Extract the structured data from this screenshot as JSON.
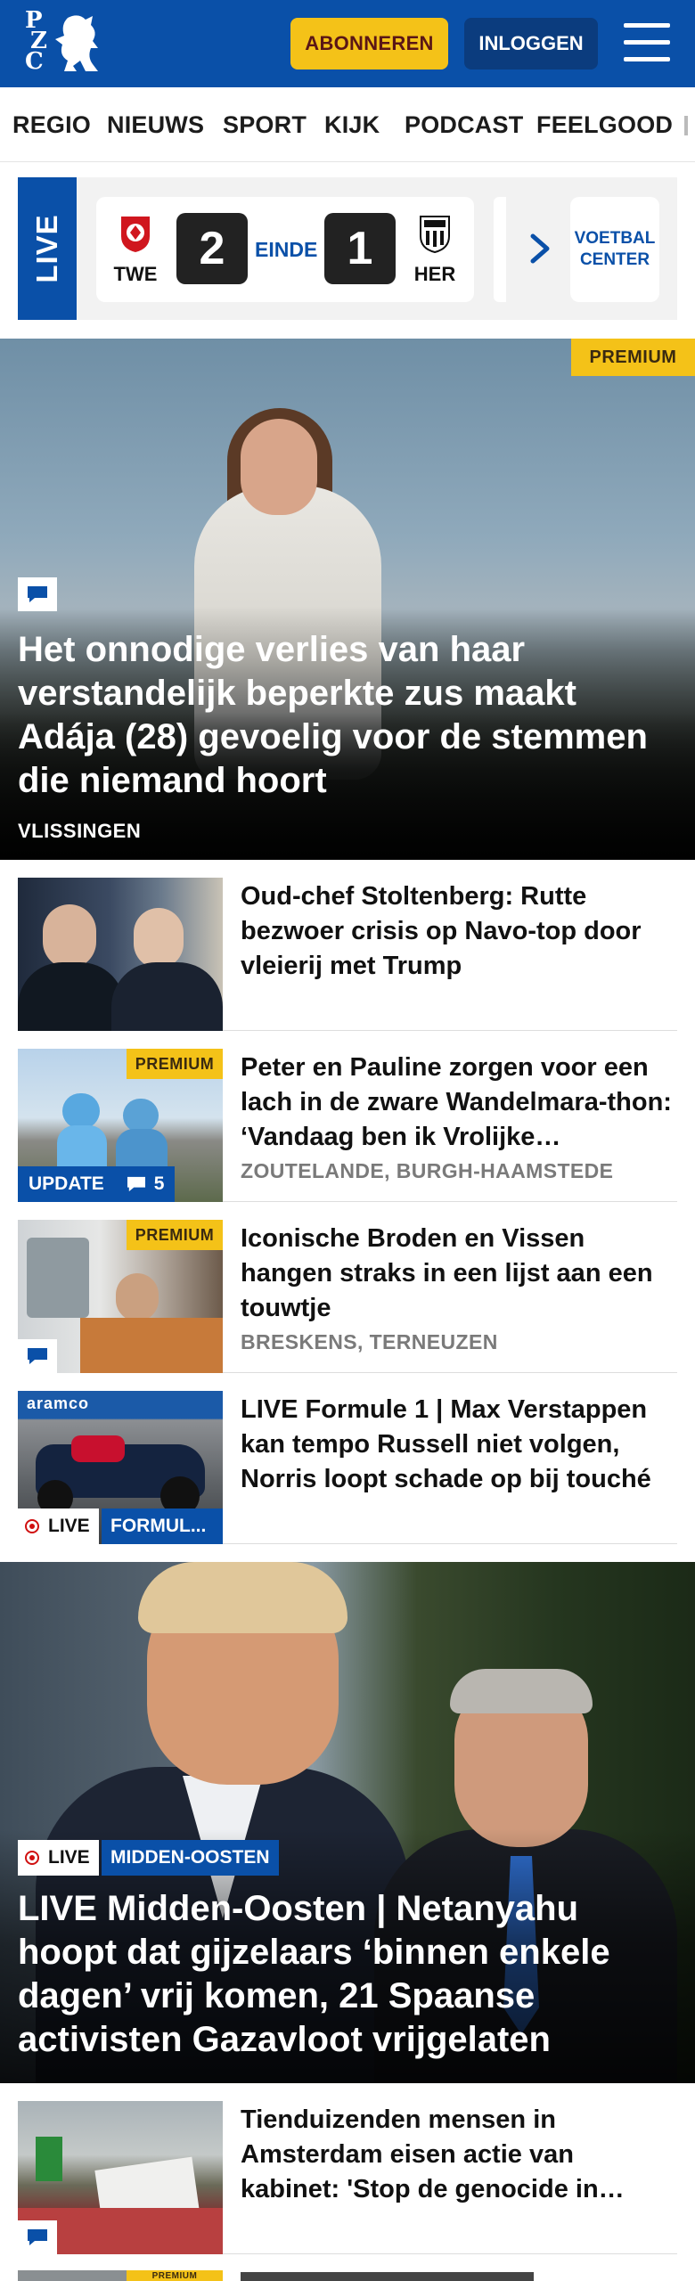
{
  "header": {
    "logo_letters": [
      "P",
      "Z",
      "C"
    ],
    "subscribe_label": "ABONNEREN",
    "login_label": "INLOGGEN",
    "brand_color": "#0a50a8",
    "accent_color": "#f4c218"
  },
  "nav": {
    "items": [
      "REGIO",
      "NIEUWS",
      "SPORT",
      "KIJK",
      "PODCAST",
      "FEELGOOD"
    ]
  },
  "live_score": {
    "live_label": "LIVE",
    "home_team": "TWE",
    "home_score": "2",
    "status": "EINDE",
    "away_score": "1",
    "away_team": "HER",
    "more_label": "VOETBAL CENTER"
  },
  "hero": {
    "premium_label": "PREMIUM",
    "title": "Het onnodige verlies van haar verstandelijk beperkte zus maakt Adája (28) gevoelig voor de stemmen die niemand hoort",
    "location": "VLISSINGEN"
  },
  "articles": [
    {
      "title": "Oud-chef Stoltenberg: Rutte bezwoer crisis op Navo-top door vleierij met Trump"
    },
    {
      "title": "Peter en Pauline zorgen voor een lach in de zware Wandelmara-thon: ‘Vandaag ben ik Vrolijke…",
      "location": "ZOUTELANDE, BURGH-HAAMSTEDE",
      "premium_label": "PREMIUM",
      "update_label": "UPDATE",
      "comment_count": "5"
    },
    {
      "title": "Iconische Broden en Vissen hangen straks in een lijst aan een touwtje",
      "location": "BRESKENS, TERNEUZEN",
      "premium_label": "PREMIUM"
    },
    {
      "title": "LIVE Formule 1 | Max Verstappen kan tempo Russell niet volgen, Norris loopt schade op bij touché",
      "live_label": "LIVE",
      "category_label": "FORMUL...",
      "banner_text": "aramco"
    }
  ],
  "big_story": {
    "live_label": "LIVE",
    "category_label": "MIDDEN-OOSTEN",
    "title": "LIVE Midden-Oosten | Netanyahu hoopt dat gijzelaars ‘binnen enkele dagen’ vrij komen, 21 Spaanse activisten Gazavloot vrijgelaten"
  },
  "article_after": {
    "title": "Tienduizenden mensen in Amsterdam eisen actie van kabinet: 'Stop de genocide in…"
  },
  "article_last": {
    "premium_label": "PREMIUM"
  }
}
